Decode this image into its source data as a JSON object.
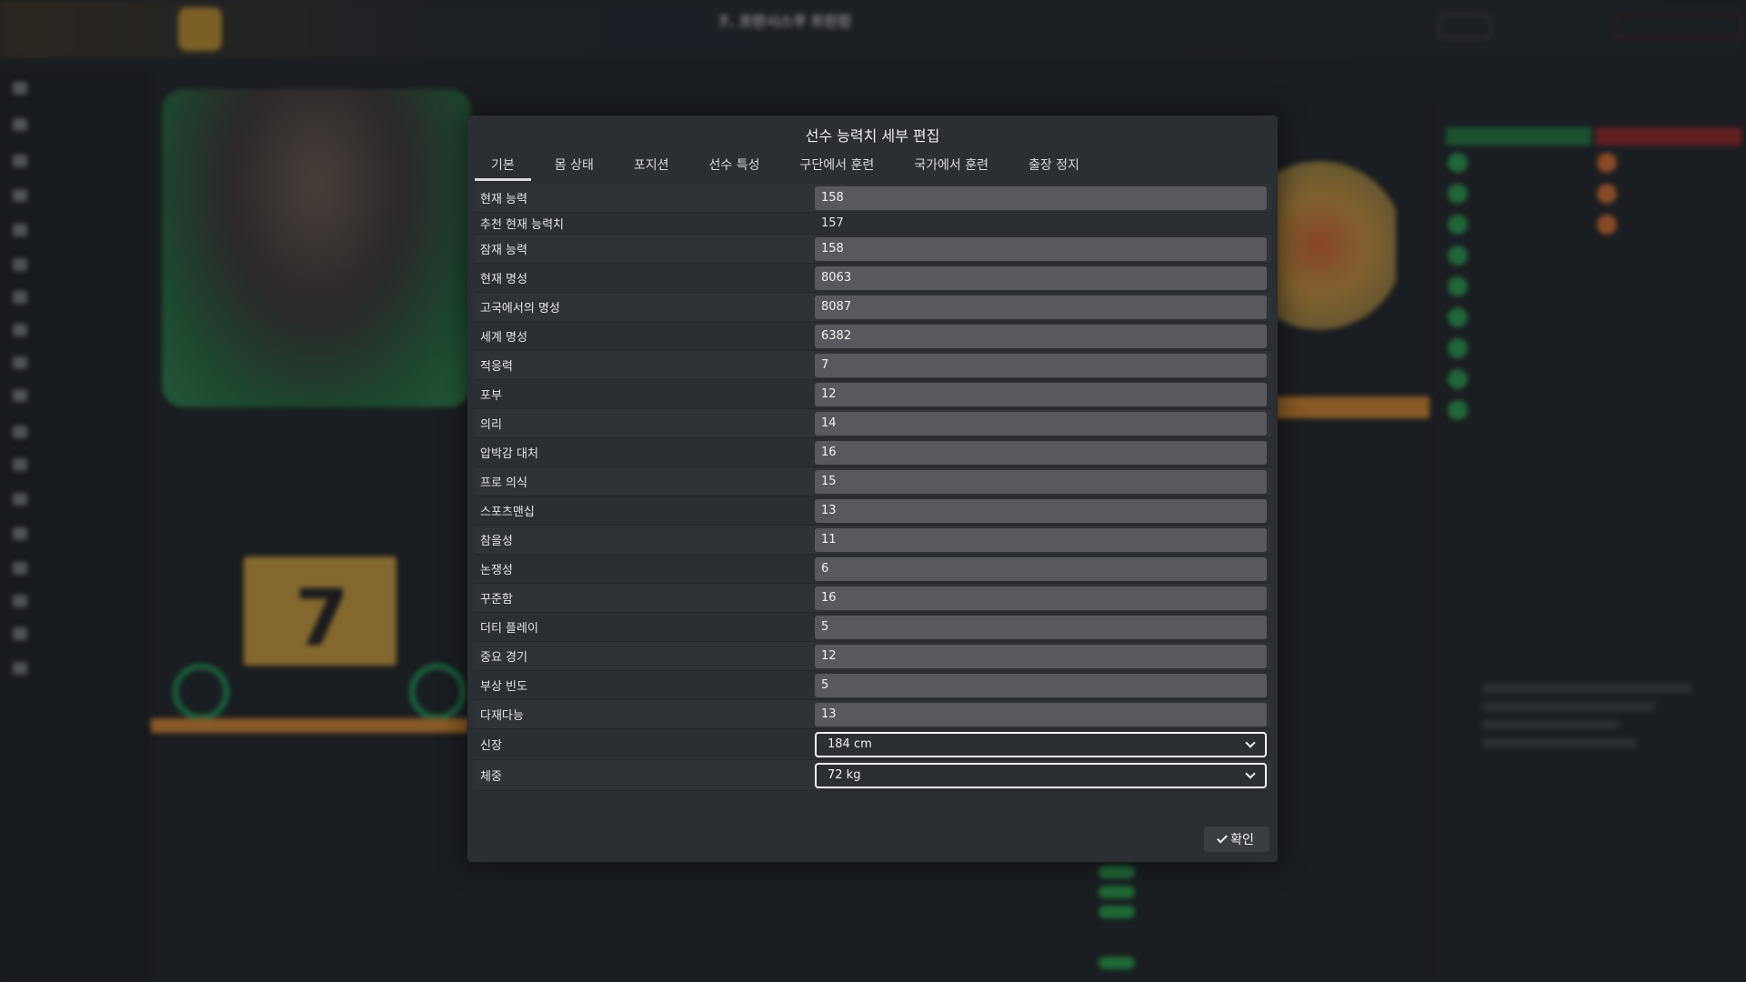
{
  "modal": {
    "title": "선수 능력치 세부 편집",
    "tabs": [
      {
        "label": "기본",
        "active": true
      },
      {
        "label": "몸 상태",
        "active": false
      },
      {
        "label": "포지션",
        "active": false
      },
      {
        "label": "선수 특성",
        "active": false
      },
      {
        "label": "구단에서 훈련",
        "active": false
      },
      {
        "label": "국가에서 훈련",
        "active": false
      },
      {
        "label": "출장 정지",
        "active": false
      }
    ],
    "fields": [
      {
        "label": "현재 능력",
        "value": "158",
        "kind": "input"
      },
      {
        "label": "추천 현재 능력치",
        "value": "157",
        "kind": "static"
      },
      {
        "label": "잠재 능력",
        "value": "158",
        "kind": "input"
      },
      {
        "label": "현재 명성",
        "value": "8063",
        "kind": "input"
      },
      {
        "label": "고국에서의 명성",
        "value": "8087",
        "kind": "input"
      },
      {
        "label": "세계 명성",
        "value": "6382",
        "kind": "input"
      },
      {
        "label": "적응력",
        "value": "7",
        "kind": "input"
      },
      {
        "label": "포부",
        "value": "12",
        "kind": "input"
      },
      {
        "label": "의리",
        "value": "14",
        "kind": "input"
      },
      {
        "label": "압박감 대처",
        "value": "16",
        "kind": "input"
      },
      {
        "label": "프로 의식",
        "value": "15",
        "kind": "input"
      },
      {
        "label": "스포츠맨십",
        "value": "13",
        "kind": "input"
      },
      {
        "label": "참을성",
        "value": "11",
        "kind": "input"
      },
      {
        "label": "논쟁성",
        "value": "6",
        "kind": "input"
      },
      {
        "label": "꾸준함",
        "value": "16",
        "kind": "input"
      },
      {
        "label": "더티 플레이",
        "value": "5",
        "kind": "input"
      },
      {
        "label": "중요 경기",
        "value": "12",
        "kind": "input"
      },
      {
        "label": "부상 빈도",
        "value": "5",
        "kind": "input"
      },
      {
        "label": "다재다능",
        "value": "13",
        "kind": "input"
      },
      {
        "label": "신장",
        "value": "184 cm",
        "kind": "select"
      },
      {
        "label": "체중",
        "value": "72 kg",
        "kind": "select"
      }
    ],
    "confirm_label": "확인"
  },
  "background": {
    "title": "7. 프란시스쿠 트린캉",
    "card_number": "7"
  }
}
